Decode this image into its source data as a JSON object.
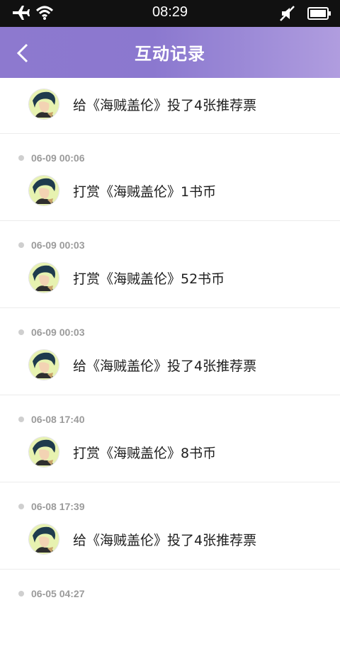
{
  "status_bar": {
    "time": "08:29",
    "left_icons": [
      "airplane-icon",
      "wifi-icon"
    ],
    "right_icons": [
      "mute-icon",
      "battery-icon"
    ]
  },
  "header": {
    "back_icon": "chevron-left-icon",
    "title": "互动记录"
  },
  "records": [
    {
      "time": "",
      "text": "给《海贼盖伦》投了4张推荐票"
    },
    {
      "time": "06-09 00:06",
      "text": "打赏《海贼盖伦》1书币"
    },
    {
      "time": "06-09 00:03",
      "text": "打赏《海贼盖伦》52书币"
    },
    {
      "time": "06-09 00:03",
      "text": "给《海贼盖伦》投了4张推荐票"
    },
    {
      "time": "06-08 17:40",
      "text": "打赏《海贼盖伦》8书币"
    },
    {
      "time": "06-08 17:39",
      "text": "给《海贼盖伦》投了4张推荐票"
    },
    {
      "time": "06-05 04:27",
      "text": ""
    }
  ],
  "colors": {
    "header": "#8b78cf",
    "status_bar": "#111111",
    "time_text": "#9b9b9b",
    "dot": "#cfcfcf"
  }
}
